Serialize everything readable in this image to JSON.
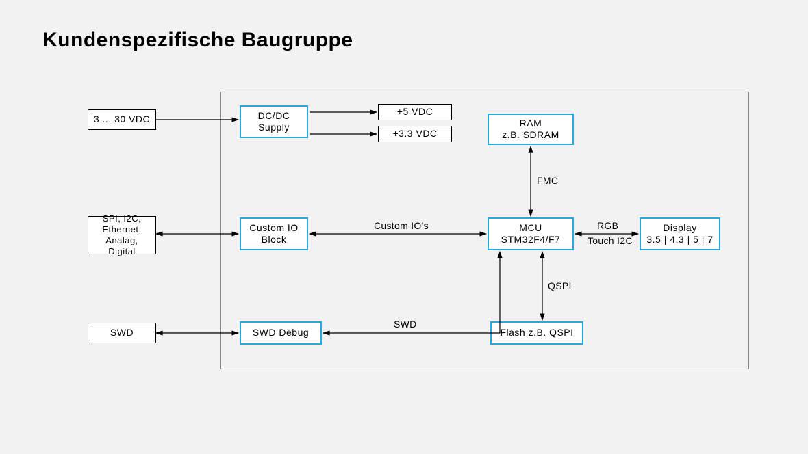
{
  "title": "Kundenspezifische Baugruppe",
  "external": {
    "power": "3 ... 30 VDC",
    "io": "SPI, I2C,\nEthernet,\nAnalag, Digital",
    "swd": "SWD"
  },
  "blocks": {
    "dcdc": "DC/DC\nSupply",
    "v5": "+5 VDC",
    "v33": "+3.3 VDC",
    "ram": "RAM\nz.B. SDRAM",
    "customio": "Custom IO\nBlock",
    "mcu": "MCU\nSTM32F4/F7",
    "display": "Display\n3.5 | 4.3 | 5 | 7",
    "swddebug": "SWD Debug",
    "flash": "Flash z.B. QSPI"
  },
  "labels": {
    "fmc": "FMC",
    "customios": "Custom IO's",
    "rgb": "RGB",
    "touch": "Touch I2C",
    "qspi": "QSPI",
    "swd": "SWD"
  }
}
